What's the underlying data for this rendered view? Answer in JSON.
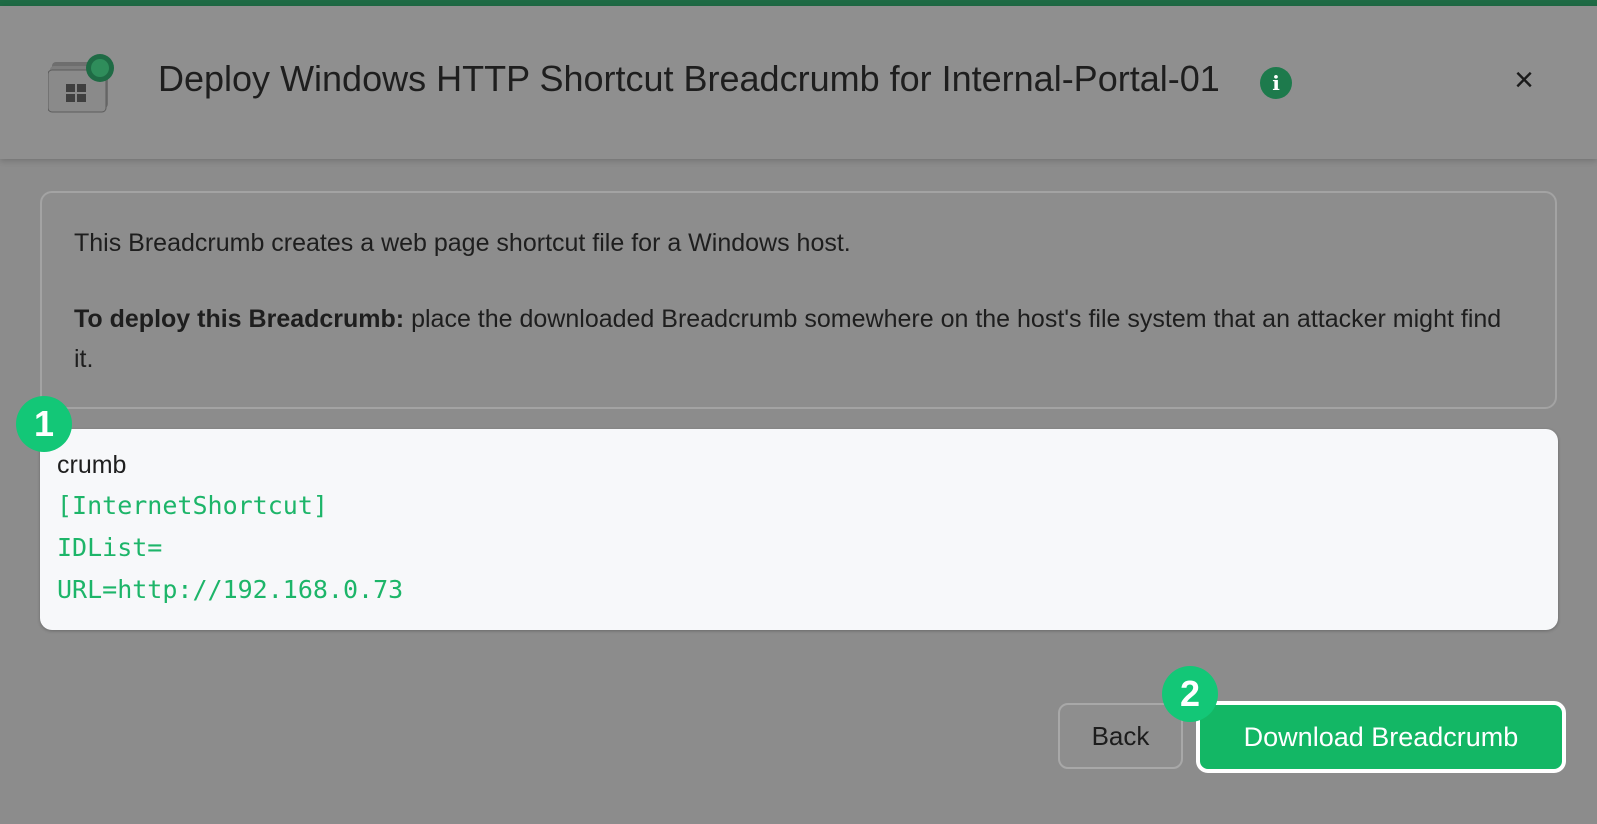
{
  "dialog": {
    "title": "Deploy Windows HTTP Shortcut Breadcrumb for Internal-Portal-01",
    "info_icon": "info-icon",
    "close_label": "×"
  },
  "description": {
    "paragraph1": "This Breadcrumb creates a web page shortcut file for a Windows host.",
    "paragraph2_bold": "To deploy this Breadcrumb:",
    "paragraph2_rest": " place the downloaded Breadcrumb somewhere on the host's file system that an attacker might find it."
  },
  "code": {
    "filename": "crumb",
    "lines": [
      "[InternetShortcut]",
      "IDList=",
      "URL=http://192.168.0.73"
    ]
  },
  "steps": {
    "step1": "1",
    "step2": "2"
  },
  "footer": {
    "back_label": "Back",
    "download_label": "Download Breadcrumb"
  },
  "colors": {
    "accent_green": "#13b765",
    "badge_green": "#13c777",
    "code_green": "#1db569",
    "info_icon_green": "#1d7a4c"
  }
}
